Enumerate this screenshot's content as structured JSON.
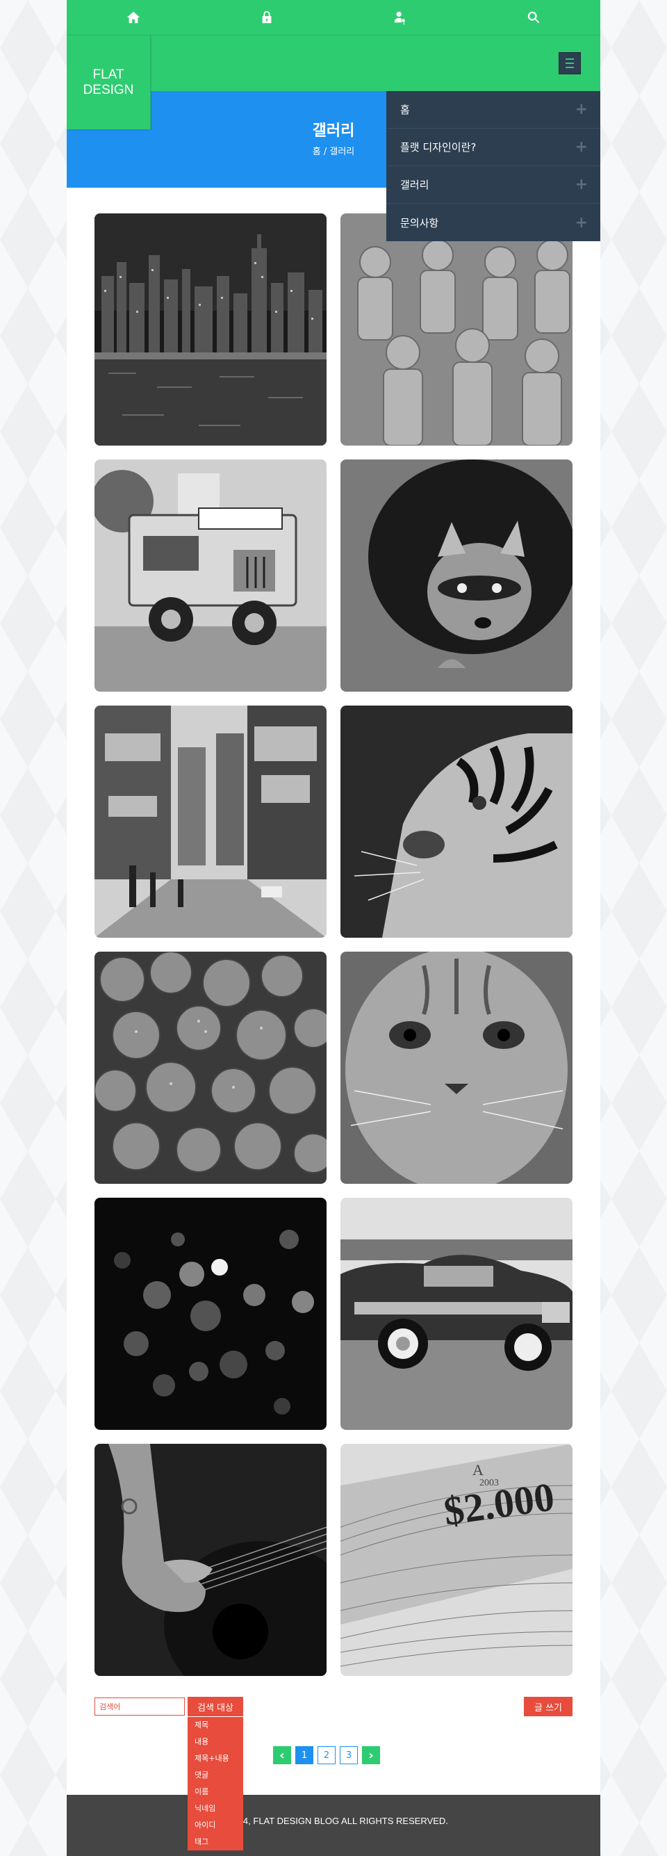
{
  "topbar": {
    "icons": [
      "home-icon",
      "lock-icon",
      "user-key-icon",
      "search-icon"
    ]
  },
  "logo": {
    "line1": "FLAT",
    "line2": "DESIGN"
  },
  "header": {
    "title": "갤러리",
    "breadcrumb": "홈 / 갤러리"
  },
  "nav": {
    "items": [
      {
        "label": "홈"
      },
      {
        "label": "플랫 디자인이란?"
      },
      {
        "label": "갤러리"
      },
      {
        "label": "문의사항"
      }
    ]
  },
  "gallery": {
    "images": [
      "city-skyline-night",
      "terracotta-warriors",
      "food-truck-jeep",
      "raccoon",
      "times-square-street",
      "tiger",
      "strawberries",
      "cat",
      "bokeh-lights",
      "vintage-car",
      "guitar-hand",
      "banknote"
    ]
  },
  "search": {
    "placeholder": "검색어",
    "target_label": "검색 대상",
    "options": [
      "제목",
      "내용",
      "제목+내용",
      "댓글",
      "이름",
      "닉네임",
      "아이디",
      "태그"
    ]
  },
  "write_label": "글 쓰기",
  "pagination": {
    "pages": [
      "1",
      "2",
      "3"
    ],
    "current": "1"
  },
  "footer": {
    "copyright": "© 2014, FLAT DESIGN BLOG ALL RIGHTS RESERVED."
  },
  "colors": {
    "green": "#2ecc71",
    "blue": "#1e90f0",
    "navy": "#2c3e50",
    "red": "#e74c3c",
    "footer": "#454545"
  }
}
